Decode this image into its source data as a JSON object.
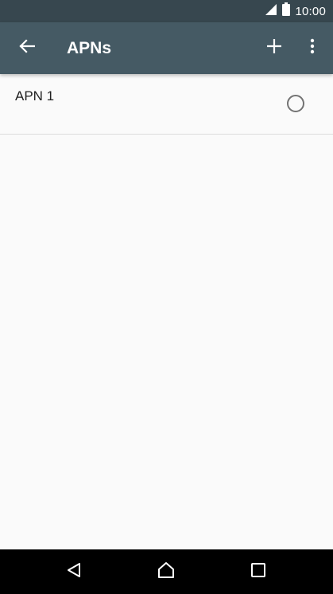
{
  "status_bar": {
    "time": "10:00",
    "icons": [
      "signal-icon",
      "battery-icon"
    ]
  },
  "app_bar": {
    "title": "APNs",
    "back_icon": "arrow-back-icon",
    "add_icon": "plus-icon",
    "more_icon": "more-vert-icon"
  },
  "apn_list": {
    "items": [
      {
        "name": "APN 1",
        "selected": false
      }
    ]
  },
  "nav_bar": {
    "icons": [
      "back-triangle-icon",
      "home-icon",
      "recents-square-icon"
    ]
  },
  "colors": {
    "status_bar": "#37474f",
    "app_bar": "#455a64",
    "background": "#fafafa",
    "nav_bar": "#000000"
  }
}
